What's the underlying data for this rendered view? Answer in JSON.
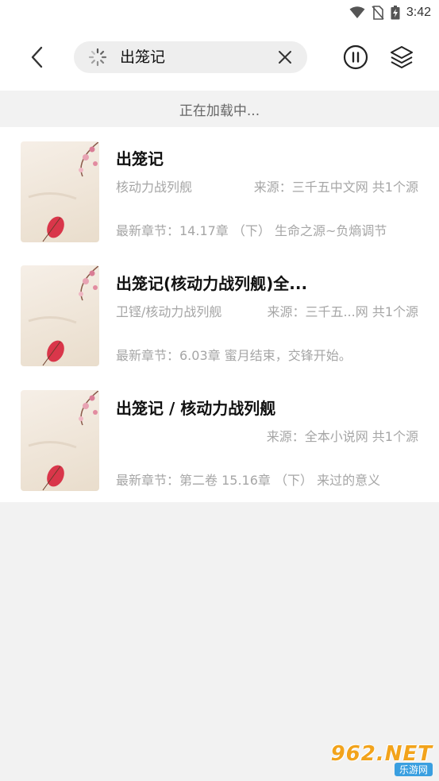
{
  "status_bar": {
    "time": "3:42",
    "icons": [
      "wifi-icon",
      "no-sim-icon",
      "battery-charging-icon"
    ]
  },
  "toolbar": {
    "back_icon": "chevron-left-icon",
    "search_query": "出笼记",
    "loading_icon": "spinner-icon",
    "clear_icon": "close-icon",
    "pause_icon": "pause-icon",
    "layers_icon": "layers-icon"
  },
  "loading_text": "正在加载中...",
  "results": [
    {
      "title": "出笼记",
      "author": "核动力战列舰",
      "source": "来源：三千五中文网 共1个源",
      "latest": "最新章节：14.17章 （下） 生命之源~负熵调节"
    },
    {
      "title": "出笼记(核动力战列舰)全...",
      "author": "卫铿/核动力战列舰",
      "source": "来源：三千五...网 共1个源",
      "latest": "最新章节：6.03章 蜜月结束，交锋开始。"
    },
    {
      "title": "出笼记 / 核动力战列舰",
      "author": "",
      "source": "来源：全本小说网 共1个源",
      "latest": "最新章节：第二卷 15.16章 （下） 来过的意义"
    }
  ],
  "watermark": {
    "main": "962.NET",
    "sub": "乐游网"
  },
  "colors": {
    "background": "#f2f2f2",
    "surface": "#ffffff",
    "muted_text": "#a6a6a6",
    "search_bg": "#eeeeee"
  }
}
